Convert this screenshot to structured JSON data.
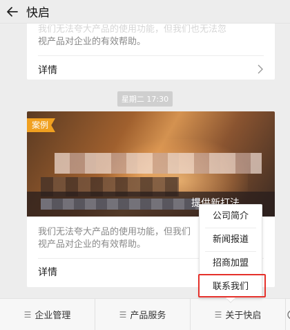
{
  "header": {
    "title": "快启"
  },
  "card_top": {
    "desc_lines": [
      "我们无法夸大产品的使用功能，但我们也无法忽",
      "视产品对企业的有效帮助。"
    ],
    "details_label": "详情"
  },
  "timestamp": "星期二 17:30",
  "card_main": {
    "case_tag": "案例",
    "caption": "提供新打法",
    "desc_lines": [
      "我们无法夸大产品的使用功能，但我们",
      "视产品对企业的有效帮助。"
    ],
    "details_label": "详情"
  },
  "popup": {
    "items": [
      "公司简介",
      "新闻报道",
      "招商加盟",
      "联系我们"
    ],
    "highlighted": "联系我们"
  },
  "bottom_nav": {
    "items": [
      "企业管理",
      "产品服务",
      "关于快启"
    ]
  },
  "colors": {
    "highlight": "#e5302a",
    "tag": "#f0a020"
  }
}
